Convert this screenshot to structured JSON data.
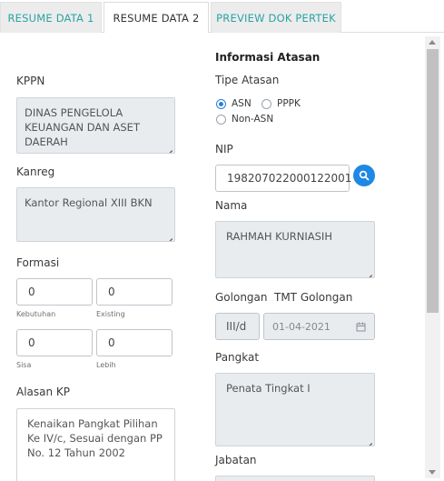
{
  "tabs": [
    {
      "label": "RESUME DATA 1"
    },
    {
      "label": "RESUME DATA 2"
    },
    {
      "label": "PREVIEW DOK PERTEK"
    }
  ],
  "left": {
    "kppn_label": "KPPN",
    "kppn_value": "DINAS PENGELOLA KEUANGAN DAN ASET DAERAH",
    "kanreg_label": "Kanreg",
    "kanreg_value": "Kantor Regional XIII BKN",
    "formasi_label": "Formasi",
    "kebutuhan_value": "0",
    "kebutuhan_label": "Kebutuhan",
    "existing_value": "0",
    "existing_label": "Existing",
    "sisa_value": "0",
    "sisa_label": "Sisa",
    "lebih_value": "0",
    "lebih_label": "Lebih",
    "alasan_label": "Alasan KP",
    "alasan_value": "Kenaikan Pangkat Pilihan Ke IV/c, Sesuai dengan PP No. 12 Tahun 2002"
  },
  "right": {
    "section_title": "Informasi Atasan",
    "tipe_label": "Tipe Atasan",
    "radio_asn": "ASN",
    "radio_pppk": "PPPK",
    "radio_non_asn": "Non-ASN",
    "selected_tipe": "ASN",
    "nip_label": "NIP",
    "nip_value": "198207022000122001",
    "nama_label": "Nama",
    "nama_value": "RAHMAH KURNIASIH",
    "golongan_label": "Golongan",
    "tmt_label": "TMT Golongan",
    "golongan_value": "III/d",
    "tmt_value": "01-04-2021",
    "pangkat_label": "Pangkat",
    "pangkat_value": "Penata Tingkat I",
    "jabatan_label": "Jabatan"
  },
  "colors": {
    "tab_inactive_text": "#2aa3a3",
    "accent_blue": "#1e88e5",
    "readonly_bg": "#e9ecef"
  },
  "icons": {
    "search": "search-icon",
    "calendar": "calendar-icon"
  }
}
